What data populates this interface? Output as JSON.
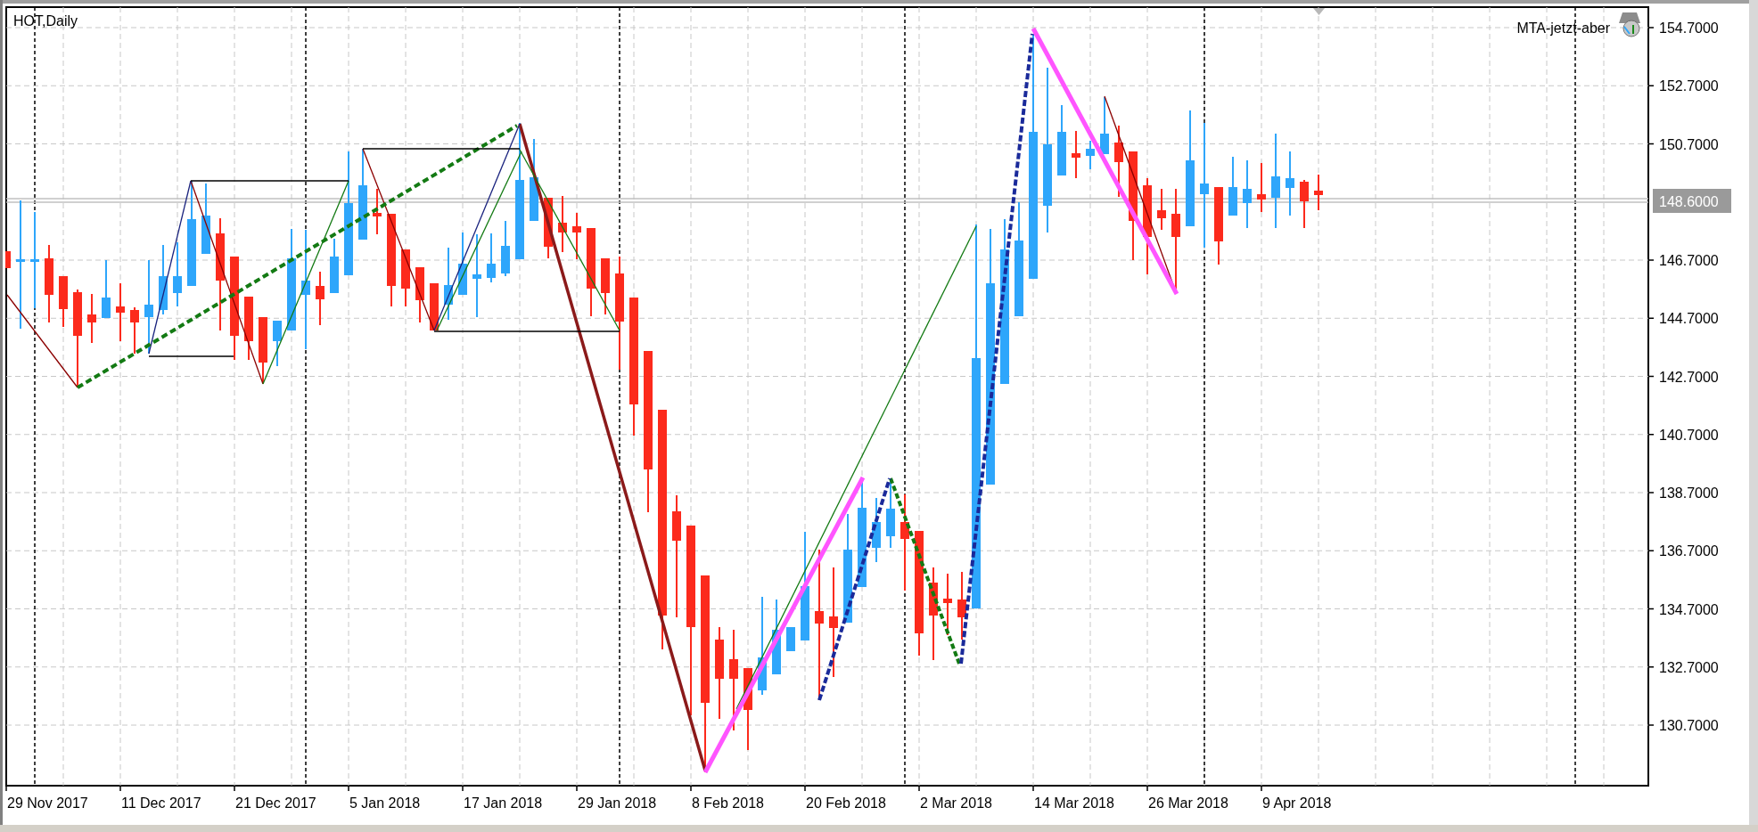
{
  "chart": {
    "title": "HOT,Daily",
    "indicator_label": "MTA-jetzt-aber",
    "price_axis": {
      "labels": [
        "154.7000",
        "152.7000",
        "150.7000",
        "146.7000",
        "144.7000",
        "142.7000",
        "140.7000",
        "138.7000",
        "136.7000",
        "134.7000",
        "132.7000",
        "130.7000"
      ]
    },
    "current_price": "148.6000",
    "time_axis": {
      "labels": [
        "29 Nov 2017",
        "11 Dec 2017",
        "21 Dec 2017",
        "5 Jan 2018",
        "17 Jan 2018",
        "29 Jan 2018",
        "8 Feb 2018",
        "20 Feb 2018",
        "2 Mar 2018",
        "14 Mar 2018",
        "26 Mar 2018",
        "9 Apr 2018"
      ]
    }
  }
}
